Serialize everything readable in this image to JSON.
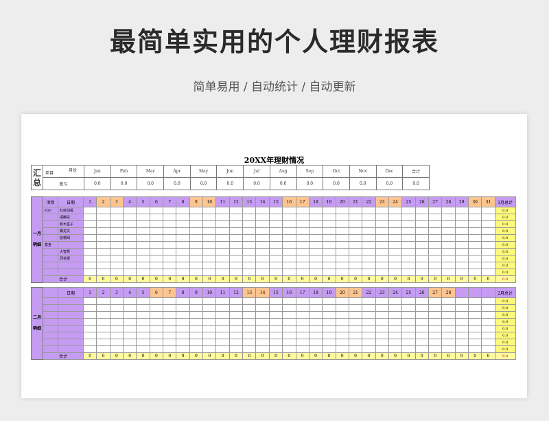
{
  "header": {
    "title": "最简单实用的个人理财报表",
    "subtitle": "简单易用  /  自动统计  /  自动更新"
  },
  "sheet": {
    "caption": "20XX年理财情况",
    "summary": {
      "section_label": "汇总",
      "diag_top": "月份",
      "diag_bottom": "项目",
      "row_label": "盈亏",
      "months": [
        "Jan",
        "Feb",
        "Mar",
        "Apr",
        "May",
        "Jun",
        "Jul",
        "Aug",
        "Sep",
        "Oct",
        "Nov",
        "Dec",
        "合计"
      ],
      "values": [
        "0.0",
        "0.0",
        "0.0",
        "0.0",
        "0.0",
        "0.0",
        "0.0",
        "0.0",
        "0.0",
        "0.0",
        "0.0",
        "0.0",
        "0.0"
      ]
    },
    "jan": {
      "section_label": "一月明细",
      "header_item": "项目",
      "header_date": "日期",
      "total_header": "1月总计",
      "days": [
        1,
        2,
        3,
        4,
        5,
        6,
        7,
        8,
        9,
        10,
        11,
        12,
        13,
        14,
        15,
        16,
        17,
        18,
        19,
        20,
        21,
        22,
        23,
        24,
        25,
        26,
        27,
        28,
        29,
        30,
        31
      ],
      "weekend_days": [
        2,
        3,
        9,
        10,
        16,
        17,
        23,
        24,
        30,
        31
      ],
      "categories": [
        "P2P",
        "",
        "",
        "",
        "",
        "基金",
        "",
        ""
      ],
      "items": [
        "红岭创投",
        "闹腾贷",
        "积木盒子",
        "翼龙贷",
        "投哪网",
        "",
        "大智慧",
        "同花顺"
      ],
      "row_totals": [
        "0.0",
        "0.0",
        "0.0",
        "0.0",
        "0.0",
        "0.0",
        "0.0",
        "0.0",
        "0.0",
        "0.0"
      ],
      "sum_label": "合计",
      "sum_value": "0",
      "grand_total": "0.0"
    },
    "feb": {
      "section_label": "二月明细",
      "header_date": "日期",
      "total_header": "2月总计",
      "days": [
        1,
        2,
        3,
        4,
        5,
        6,
        7,
        8,
        9,
        10,
        11,
        12,
        13,
        14,
        15,
        16,
        17,
        18,
        19,
        20,
        21,
        22,
        23,
        24,
        25,
        26,
        27,
        28
      ],
      "weekend_days": [
        6,
        7,
        13,
        14,
        20,
        21,
        27,
        28
      ],
      "row_totals": [
        "0.0",
        "0.0",
        "0.0",
        "0.0",
        "0.0",
        "0.0",
        "0.0",
        "0.0"
      ],
      "sum_label": "合计",
      "sum_value": "0",
      "grand_total": "0.0"
    }
  },
  "colors": {
    "purple": "#c59cf2",
    "orange": "#fcc590",
    "yellow": "#fff97b",
    "red": "#e8161b"
  }
}
